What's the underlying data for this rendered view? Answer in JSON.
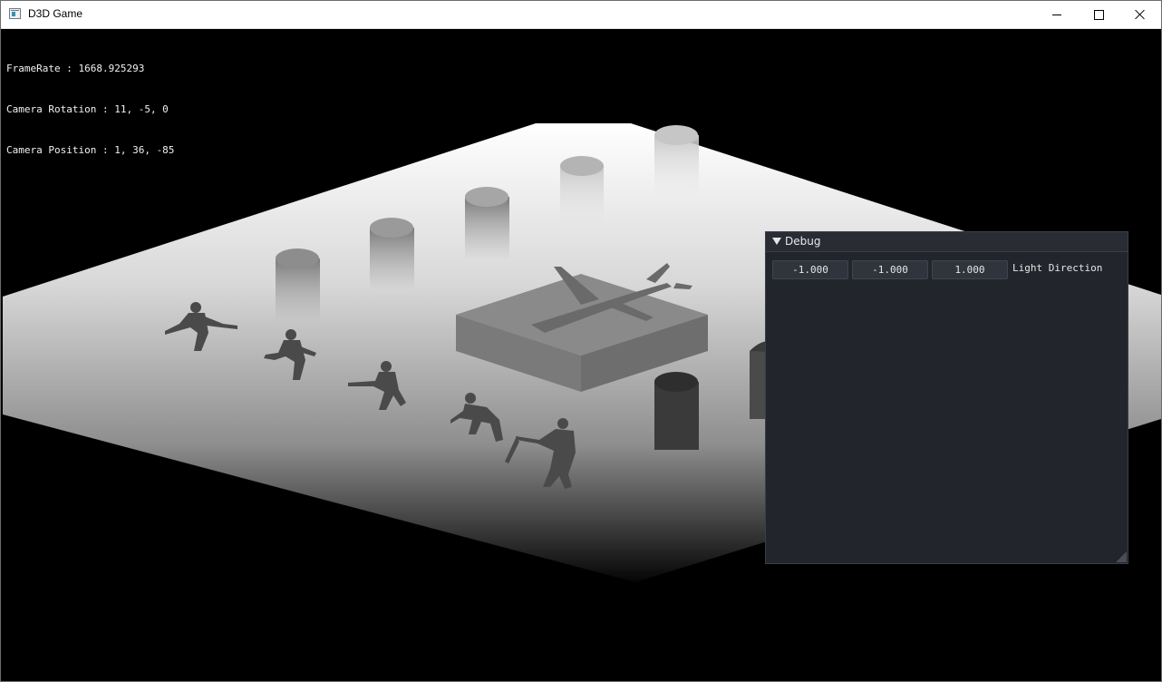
{
  "window": {
    "title": "D3D Game",
    "app_icon": "window-app-icon",
    "controls": {
      "minimize_icon": "minimize-icon",
      "maximize_icon": "maximize-icon",
      "close_icon": "close-icon"
    }
  },
  "hud": {
    "framerate": "FrameRate : 1668.925293",
    "camera_rotation": "Camera Rotation : 11, -5, 0",
    "camera_position": "Camera Position : 1, 36, -85"
  },
  "debug_panel": {
    "title": "Debug",
    "collapse_icon": "collapse-triangle-icon",
    "light_direction": {
      "x": "-1.000",
      "y": "-1.000",
      "z": "1.000",
      "label": "Light Direction"
    }
  },
  "colors": {
    "panel_bg": "#22252c",
    "panel_title_bg": "#292c34",
    "field_bg": "#30343d",
    "hud_text": "#f2f2f2"
  }
}
